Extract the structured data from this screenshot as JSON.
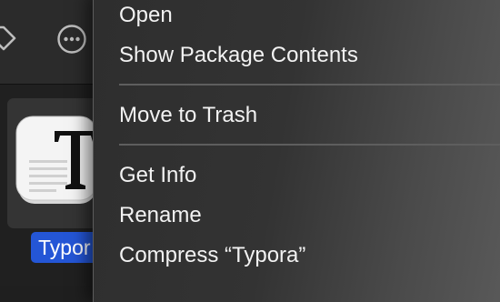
{
  "finder": {
    "icons": {
      "tag": "tag-icon",
      "more": "ellipsis-circle-icon",
      "app": "typora-app-icon"
    },
    "selected_file_label": "Typor"
  },
  "context_menu": {
    "open": "Open",
    "show_package_contents": "Show Package Contents",
    "move_to_trash": "Move to Trash",
    "get_info": "Get Info",
    "rename": "Rename",
    "compress": "Compress “Typora”"
  },
  "colors": {
    "selection_blue": "#2456d6",
    "menu_text": "#f2f2f2",
    "separator": "#5e5e5e"
  }
}
